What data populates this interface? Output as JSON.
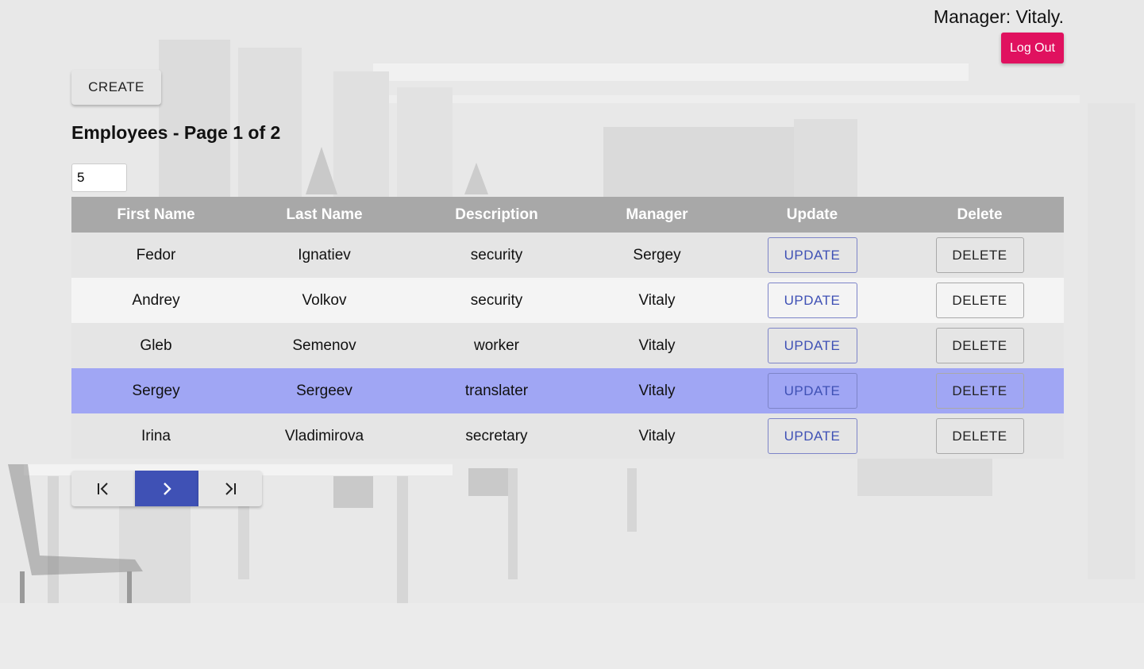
{
  "header": {
    "manager_text": "Manager: Vitaly.",
    "logout_label": "Log Out"
  },
  "toolbar": {
    "create_label": "CREATE"
  },
  "page_title": "Employees - Page 1 of 2",
  "page_size": {
    "value": "5"
  },
  "table": {
    "columns": [
      "First Name",
      "Last Name",
      "Description",
      "Manager",
      "Update",
      "Delete"
    ],
    "update_label": "UPDATE",
    "delete_label": "DELETE",
    "rows": [
      {
        "first_name": "Fedor",
        "last_name": "Ignatiev",
        "description": "security",
        "manager": "Sergey"
      },
      {
        "first_name": "Andrey",
        "last_name": "Volkov",
        "description": "security",
        "manager": "Vitaly"
      },
      {
        "first_name": "Gleb",
        "last_name": "Semenov",
        "description": "worker",
        "manager": "Vitaly"
      },
      {
        "first_name": "Sergey",
        "last_name": "Sergeev",
        "description": "translater",
        "manager": "Vitaly"
      },
      {
        "first_name": "Irina",
        "last_name": "Vladimirova",
        "description": "secretary",
        "manager": "Vitaly"
      }
    ]
  },
  "pagination": {
    "buttons": [
      {
        "icon": "first-page-icon"
      },
      {
        "icon": "chevron-right-icon"
      },
      {
        "icon": "last-page-icon"
      }
    ]
  },
  "colors": {
    "logout": "#e0115f",
    "primary": "#3f51b5",
    "selected_row": "#a0a6f4",
    "header_row": "#a8a8a8"
  }
}
